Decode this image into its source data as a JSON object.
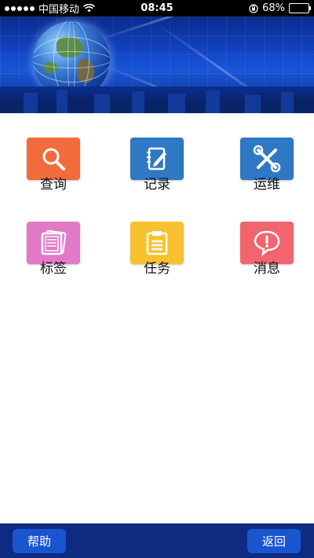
{
  "status_bar": {
    "carrier": "中国移动",
    "time": "08:45",
    "battery_percent": "68%",
    "battery_level": 0.68
  },
  "menu": {
    "items": [
      {
        "label": "查询",
        "icon": "search-icon",
        "color": "#f26b3a"
      },
      {
        "label": "记录",
        "icon": "notebook-icon",
        "color": "#2f78c4"
      },
      {
        "label": "运维",
        "icon": "tools-icon",
        "color": "#2f78c4"
      },
      {
        "label": "标签",
        "icon": "tag-card-icon",
        "color": "#e27ac8"
      },
      {
        "label": "任务",
        "icon": "clipboard-icon",
        "color": "#f7c22e"
      },
      {
        "label": "消息",
        "icon": "message-icon",
        "color": "#f2646e"
      }
    ]
  },
  "bottom_bar": {
    "help_label": "帮助",
    "back_label": "返回"
  }
}
